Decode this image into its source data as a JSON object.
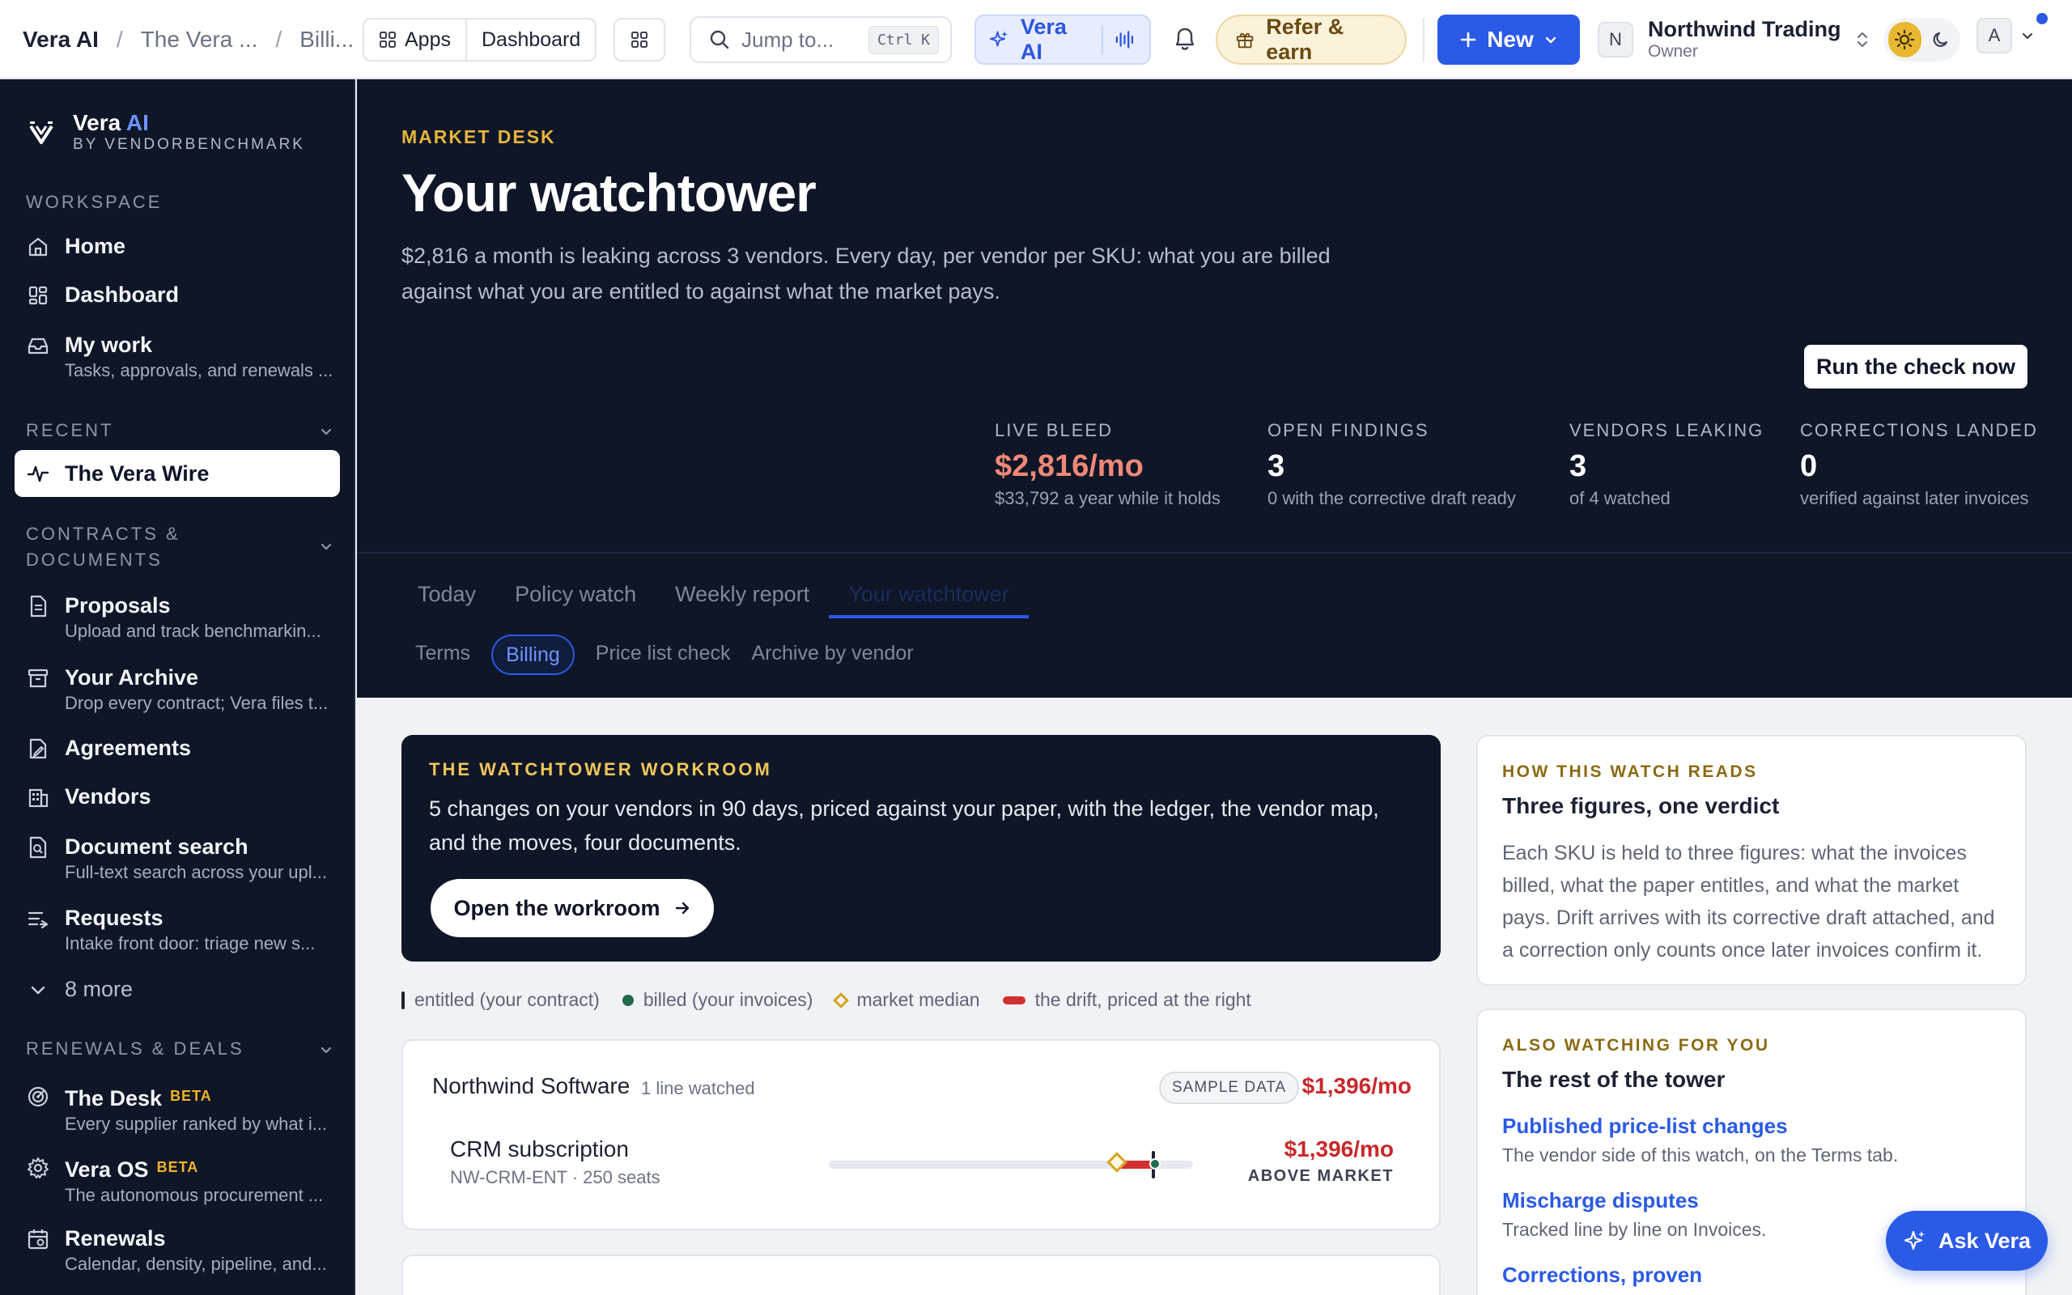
{
  "breadcrumbs": [
    "Vera AI",
    "The Vera ...",
    "Billi..."
  ],
  "topbar": {
    "apps_label": "Apps",
    "dashboard_label": "Dashboard",
    "search_placeholder": "Jump to...",
    "search_shortcut": "Ctrl K",
    "vera_ai_label": "Vera AI",
    "refer_label": "Refer & earn",
    "new_label": "New",
    "org_initial": "N",
    "org_name": "Northwind Trading",
    "org_role": "Owner",
    "user_initial": "A"
  },
  "sidebar": {
    "brand_name": "Vera",
    "brand_ai": "AI",
    "brand_by": "BY VENDORBENCHMARK",
    "workspace_heading": "WORKSPACE",
    "workspace_items": [
      {
        "label": "Home",
        "sub": "",
        "icon": "home-icon"
      },
      {
        "label": "Dashboard",
        "sub": "",
        "icon": "dashboard-icon"
      },
      {
        "label": "My work",
        "sub": "Tasks, approvals, and renewals ...",
        "icon": "inbox-icon"
      }
    ],
    "recent_heading": "RECENT",
    "recent_items": [
      {
        "label": "The Vera Wire",
        "icon": "activity-icon"
      }
    ],
    "contracts_heading_1": "CONTRACTS &",
    "contracts_heading_2": "DOCUMENTS",
    "contracts_items": [
      {
        "label": "Proposals",
        "sub": "Upload and track benchmarkin...",
        "icon": "file-icon"
      },
      {
        "label": "Your Archive",
        "sub": "Drop every contract; Vera files t...",
        "icon": "archive-icon"
      },
      {
        "label": "Agreements",
        "sub": "",
        "icon": "signature-icon"
      },
      {
        "label": "Vendors",
        "sub": "",
        "icon": "building-icon"
      },
      {
        "label": "Document search",
        "sub": "Full-text search across your upl...",
        "icon": "doc-search-icon"
      },
      {
        "label": "Requests",
        "sub": "Intake front door: triage new s...",
        "icon": "requests-icon"
      }
    ],
    "more_label": "8 more",
    "renewals_heading": "RENEWALS & DEALS",
    "renewals_items": [
      {
        "label": "The Desk",
        "badge": "BETA",
        "sub": "Every supplier ranked by what i...",
        "icon": "radar-icon"
      },
      {
        "label": "Vera OS",
        "badge": "BETA",
        "sub": "The autonomous procurement ...",
        "icon": "cog-icon"
      },
      {
        "label": "Renewals",
        "badge": "",
        "sub": "Calendar, density, pipeline, and...",
        "icon": "calendar-icon"
      }
    ]
  },
  "hero": {
    "eyebrow": "MARKET DESK",
    "title": "Your watchtower",
    "description": "$2,816 a month is leaking across 3 vendors. Every day, per vendor per SKU: what you are billed against what you are entitled to against what the market pays.",
    "run_button": "Run the check now",
    "stats": [
      {
        "key": "LIVE BLEED",
        "value": "$2,816/mo",
        "sub": "$33,792 a year while it holds"
      },
      {
        "key": "OPEN FINDINGS",
        "value": "3",
        "sub": "0 with the corrective draft ready"
      },
      {
        "key": "VENDORS LEAKING",
        "value": "3",
        "sub": "of 4 watched"
      },
      {
        "key": "CORRECTIONS LANDED",
        "value": "0",
        "sub": "verified against later invoices"
      }
    ]
  },
  "tabs": [
    "Today",
    "Policy watch",
    "Weekly report",
    "Your watchtower"
  ],
  "active_tab": "Your watchtower",
  "subtabs": [
    "Terms",
    "Billing",
    "Price list check",
    "Archive by vendor"
  ],
  "active_subtab": "Billing",
  "workroom": {
    "eyebrow": "THE WATCHTOWER WORKROOM",
    "text": "5 changes on your vendors in 90 days, priced against your paper, with the ledger, the vendor map, and the moves, four documents.",
    "button": "Open the workroom"
  },
  "legend": {
    "entitled": "entitled (your contract)",
    "billed": "billed (your invoices)",
    "market": "market median",
    "drift": "the drift, priced at the right"
  },
  "vendors": [
    {
      "name": "Northwind Software",
      "lines_watched": "1 line watched",
      "tag": "SAMPLE DATA",
      "amount": "$1,396/mo",
      "sku_name": "CRM subscription",
      "sku_detail": "NW-CRM-ENT · 250 seats",
      "sku_amount": "$1,396/mo",
      "sku_state": "ABOVE MARKET",
      "market_pos": 0.79,
      "entitled_pos": 0.89,
      "billed_pos": 0.9
    }
  ],
  "how": {
    "eyebrow": "HOW THIS WATCH READS",
    "heading": "Three figures, one verdict",
    "body": "Each SKU is held to three figures: what the invoices billed, what the paper entitles, and what the market pays. Drift arrives with its corrective draft attached, and a correction only counts once later invoices confirm it."
  },
  "also": {
    "eyebrow": "ALSO WATCHING FOR YOU",
    "heading": "The rest of the tower",
    "links": [
      {
        "label": "Published price-list changes",
        "sub": "The vendor side of this watch, on the Terms tab."
      },
      {
        "label": "Mischarge disputes",
        "sub": "Tracked line by line on Invoices."
      },
      {
        "label": "Corrections, proven",
        "sub": ""
      }
    ]
  },
  "ask_vera_label": "Ask Vera",
  "colors": {
    "accent": "#2b5ae6",
    "dark": "#0e1627",
    "gold": "#e6b43c",
    "alert": "#c8282b"
  }
}
